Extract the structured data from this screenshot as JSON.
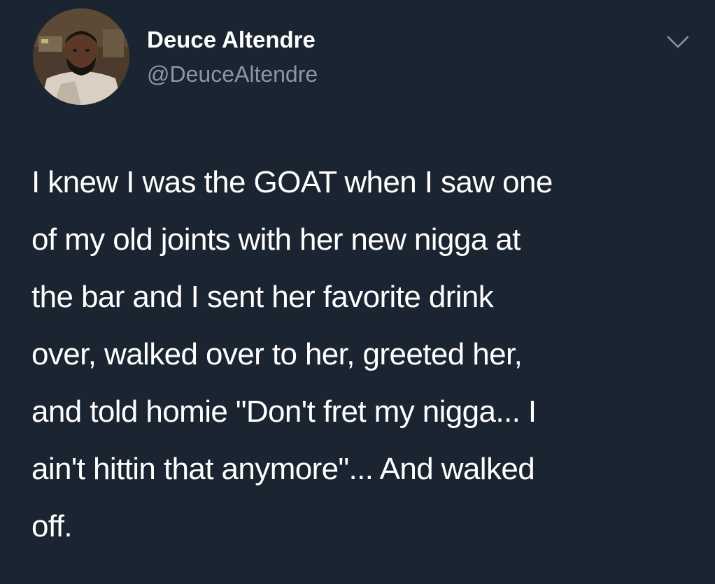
{
  "tweet": {
    "author": {
      "display_name": "Deuce Altendre",
      "handle": "@DeuceAltendre",
      "avatar_icon": "profile-photo-avatar"
    },
    "menu_icon": "chevron-down-icon",
    "text_lines": [
      "I knew I was the GOAT when I saw one",
      "of my old joints with her new nigga at",
      "the bar and I sent her favorite drink",
      "over, walked over to her, greeted her,",
      "and told homie \"Don't fret my nigga... I",
      "ain't hittin that anymore\"... And walked",
      "off."
    ]
  },
  "colors": {
    "background": "#1b2431",
    "primary_text": "#ffffff",
    "secondary_text": "#8899a6",
    "chevron": "#8899a6"
  }
}
